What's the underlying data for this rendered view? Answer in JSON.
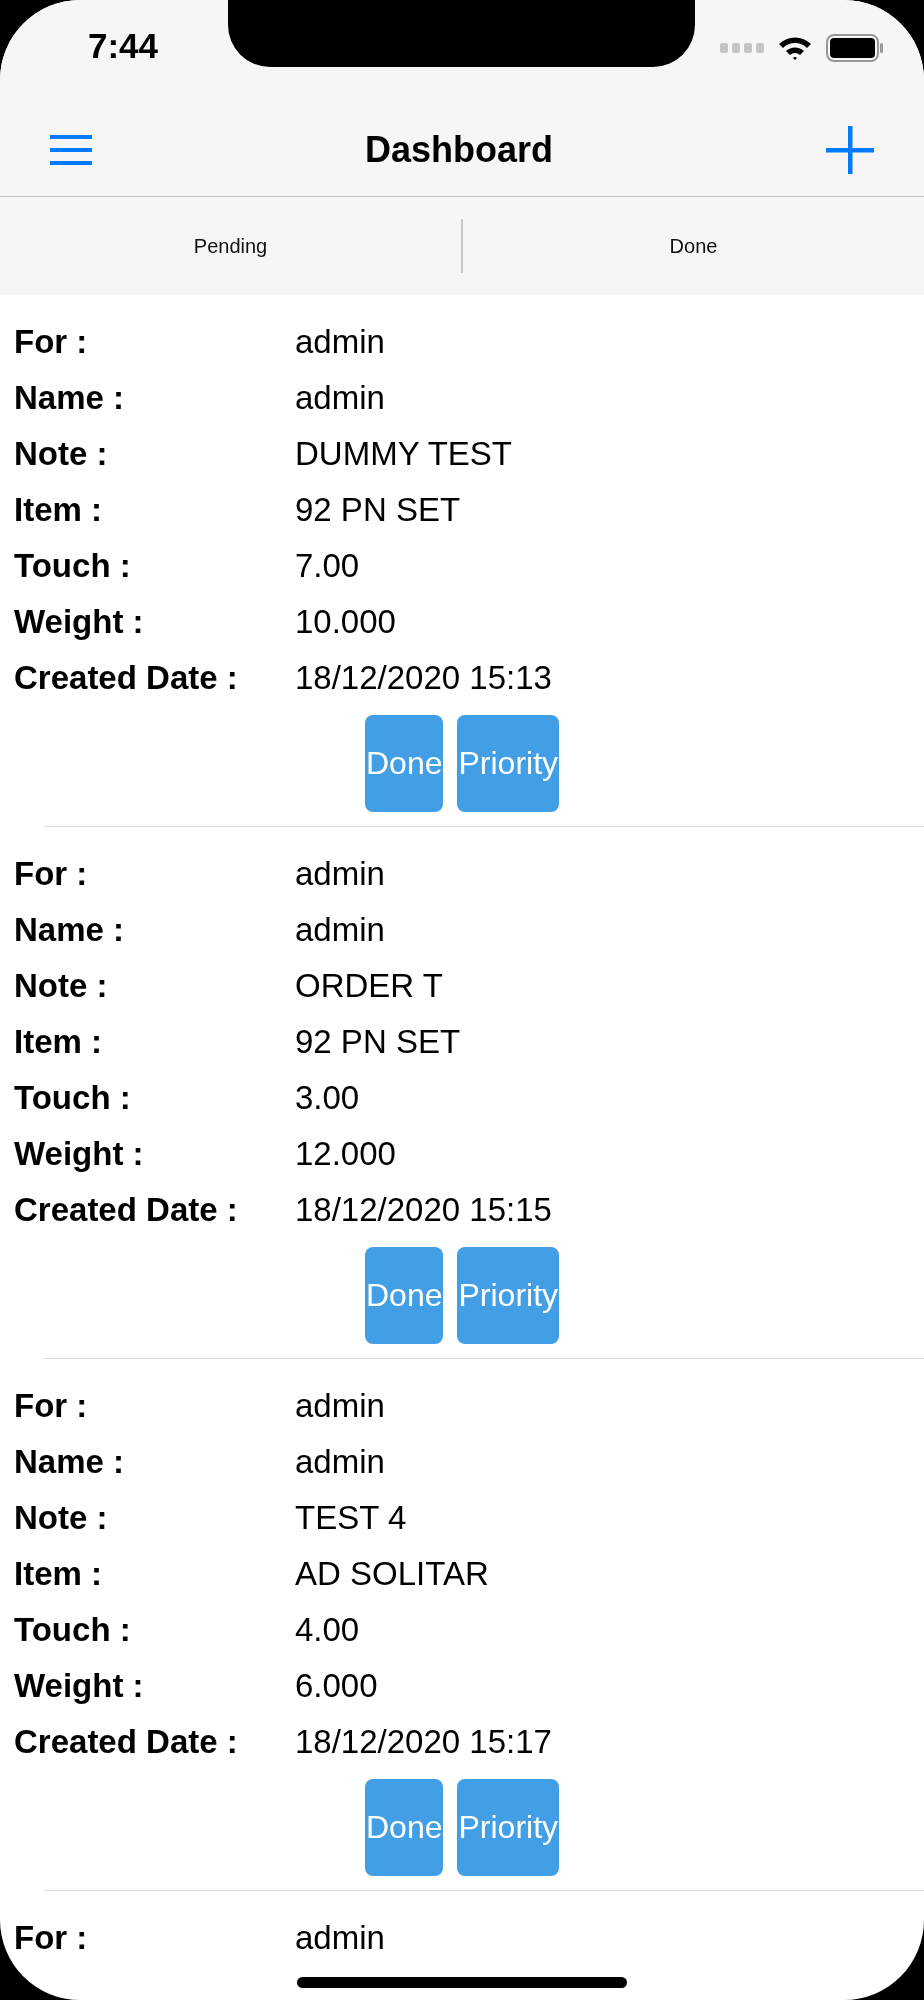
{
  "status_bar": {
    "time": "7:44"
  },
  "nav_bar": {
    "title": "Dashboard"
  },
  "tabs": [
    {
      "label": "Pending",
      "selected": false
    },
    {
      "label": "Done",
      "selected": false
    }
  ],
  "orders": [
    {
      "fields": [
        {
          "label": "For :",
          "value": "admin"
        },
        {
          "label": "Name :",
          "value": "admin"
        },
        {
          "label": "Note :",
          "value": "DUMMY TEST"
        },
        {
          "label": "Item :",
          "value": "92 PN SET"
        },
        {
          "label": "Touch :",
          "value": "7.00"
        },
        {
          "label": "Weight :",
          "value": "10.000"
        },
        {
          "label": "Created Date :",
          "value": "18/12/2020 15:13"
        }
      ],
      "buttons": [
        "Done",
        "Priority"
      ]
    },
    {
      "fields": [
        {
          "label": "For :",
          "value": "admin"
        },
        {
          "label": "Name :",
          "value": "admin"
        },
        {
          "label": "Note :",
          "value": "ORDER T"
        },
        {
          "label": "Item :",
          "value": "92 PN SET"
        },
        {
          "label": "Touch :",
          "value": "3.00"
        },
        {
          "label": "Weight :",
          "value": "12.000"
        },
        {
          "label": "Created Date :",
          "value": "18/12/2020 15:15"
        }
      ],
      "buttons": [
        "Done",
        "Priority"
      ]
    },
    {
      "fields": [
        {
          "label": "For :",
          "value": "admin"
        },
        {
          "label": "Name :",
          "value": "admin"
        },
        {
          "label": "Note :",
          "value": "TEST 4"
        },
        {
          "label": "Item :",
          "value": "AD SOLITAR"
        },
        {
          "label": "Touch :",
          "value": "4.00"
        },
        {
          "label": "Weight :",
          "value": "6.000"
        },
        {
          "label": "Created Date :",
          "value": "18/12/2020 15:17"
        }
      ],
      "buttons": [
        "Done",
        "Priority"
      ]
    },
    {
      "fields": [
        {
          "label": "For :",
          "value": "admin"
        }
      ]
    }
  ]
}
